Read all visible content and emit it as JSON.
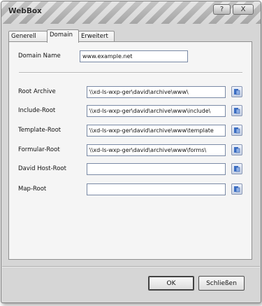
{
  "window": {
    "title": "WebBox"
  },
  "titlebar": {
    "help_label": "?",
    "close_label": "X"
  },
  "tabs": [
    {
      "label": "Generell"
    },
    {
      "label": "Domain"
    },
    {
      "label": "Erweitert"
    }
  ],
  "domain": {
    "label": "Domain Name",
    "value": "www.example.net"
  },
  "fields": [
    {
      "label": "Root Archive",
      "value": "\\\\xd-ls-wxp-ger\\david\\archive\\www\\"
    },
    {
      "label": "Include-Root",
      "value": "\\\\xd-ls-wxp-ger\\david\\archive\\www\\include\\"
    },
    {
      "label": "Template-Root",
      "value": "\\\\xd-ls-wxp-ger\\david\\archive\\www\\template"
    },
    {
      "label": "Formular-Root",
      "value": "\\\\xd-ls-wxp-ger\\david\\archive\\www\\forms\\"
    },
    {
      "label": "David Host-Root",
      "value": ""
    },
    {
      "label": "Map-Root",
      "value": ""
    }
  ],
  "buttons": {
    "ok": "OK",
    "close": "Schließen"
  }
}
